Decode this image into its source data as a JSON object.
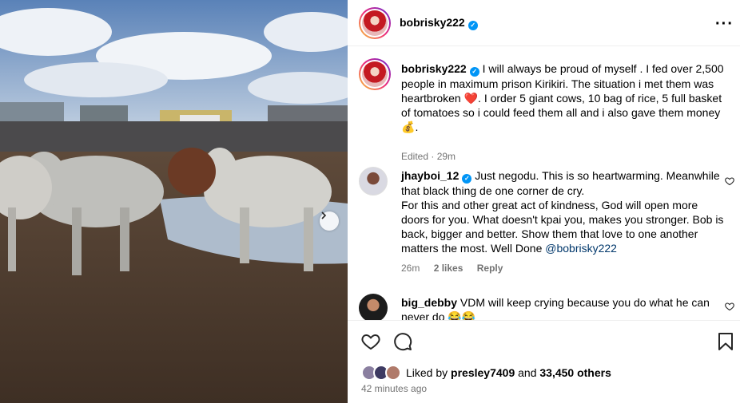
{
  "post": {
    "username": "bobrisky222",
    "more_icon": "more-horizontal-icon"
  },
  "caption": {
    "username": "bobrisky222",
    "text_1": "I will always be proud of myself . I fed over 2,500 people in maximum prison Kirikiri. The situation i met them was heartbroken ",
    "emoji_1": "❤️",
    "text_2": ". I order 5 giant cows, 10 bag of rice, 5 full basket of tomatoes so i could feed them all and i also gave them money ",
    "emoji_2": "💰",
    "text_3": ".",
    "edited": "Edited · 29m"
  },
  "comments": [
    {
      "username": "jhayboi_12",
      "verified": true,
      "text_1": "Just negodu. This is so heartwarming. Meanwhile that black thing de one corner de cry.",
      "text_2": "For this and other great act of kindness, God will open more doors for you. What doesn't kpai you, makes you stronger. Bob is back, bigger and better. Show them that love to one another matters the most. Well Done ",
      "mention": "@bobrisky222",
      "time": "26m",
      "likes": "2 likes",
      "reply": "Reply"
    },
    {
      "username": "big_debby",
      "verified": false,
      "text_1": "VDM will keep crying because you do what he can never do ",
      "emoji": "😂😂"
    }
  ],
  "actions": {
    "liked_prefix": "Liked by",
    "liked_user": "presley7409",
    "liked_and": "and",
    "liked_others": "33,450 others",
    "timestamp": "42 minutes ago"
  },
  "colors": {
    "verified": "#0095f6",
    "muted": "#737373",
    "mention": "#00376b"
  }
}
